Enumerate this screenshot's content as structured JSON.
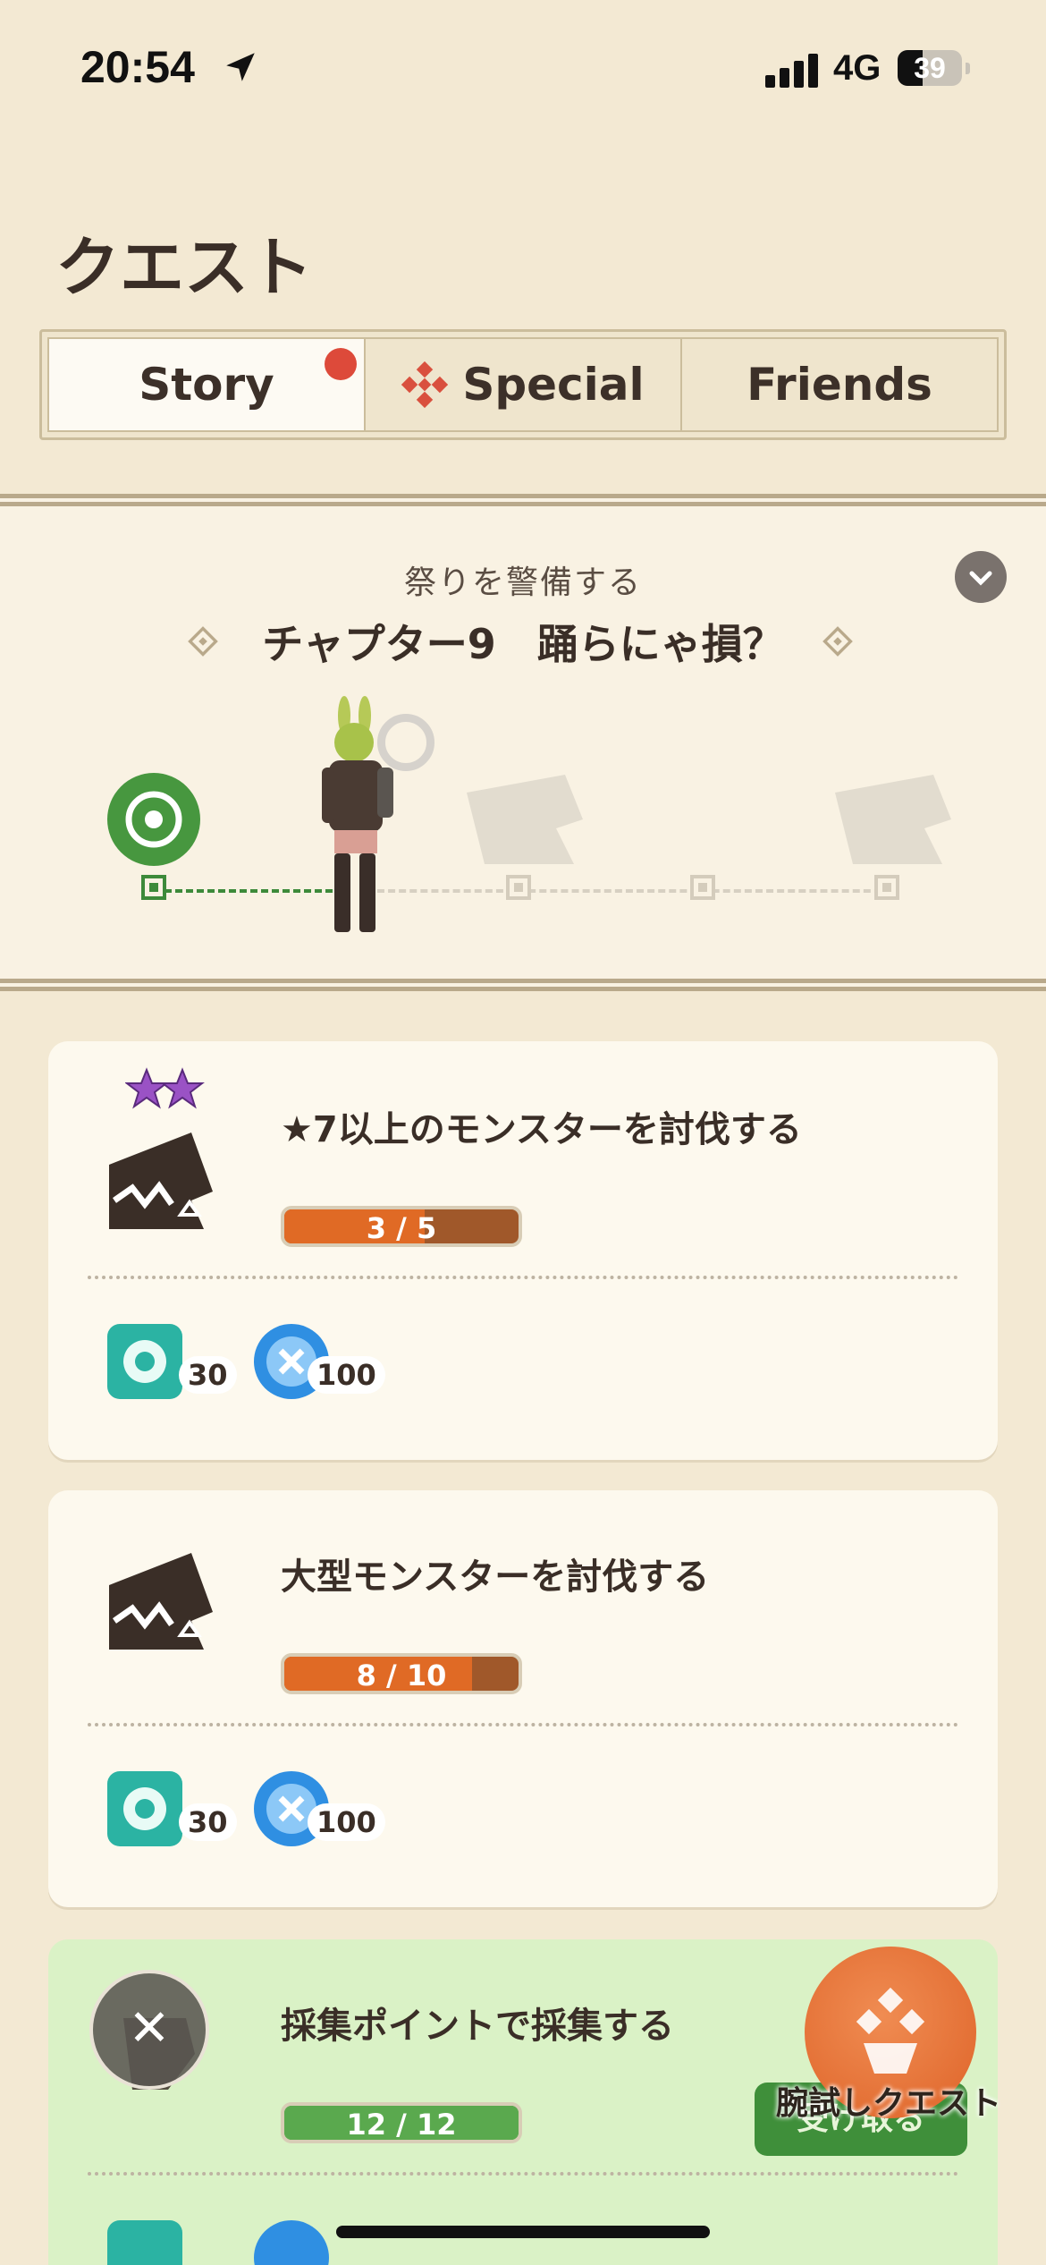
{
  "status_bar": {
    "time": "20:54",
    "network": "4G",
    "battery": "39",
    "battery_level": 0.39
  },
  "page_title": "クエスト",
  "tabs": [
    {
      "label": "Story",
      "active": true,
      "has_badge": true
    },
    {
      "label": "Special",
      "active": false,
      "icon": "special-emblem-icon"
    },
    {
      "label": "Friends",
      "active": false
    }
  ],
  "chapter": {
    "subtitle": "祭りを警備する",
    "title": "チャプター9　踊らにゃ損？"
  },
  "quests": [
    {
      "title": "★7以上のモンスターを討伐する",
      "progress_label": "3 / 5",
      "progress_value": 0.6,
      "stars": 2,
      "rewards": [
        {
          "icon": "gem-ticket-icon",
          "count": "30"
        },
        {
          "icon": "blue-orb-icon",
          "count": "100"
        }
      ]
    },
    {
      "title": "大型モンスターを討伐する",
      "progress_label": "8 / 10",
      "progress_value": 0.8,
      "rewards": [
        {
          "icon": "gem-ticket-icon",
          "count": "30"
        },
        {
          "icon": "blue-orb-icon",
          "count": "100"
        }
      ]
    },
    {
      "title": "採集ポイントで採集する",
      "progress_label": "12 / 12",
      "progress_value": 1.0,
      "claim_label": "受け取る"
    }
  ],
  "fab": {
    "label": "腕試しクエスト"
  },
  "colors": {
    "accent_orange": "#e06a25",
    "accent_green": "#3d8a3a",
    "badge_red": "#dd4a3a"
  }
}
